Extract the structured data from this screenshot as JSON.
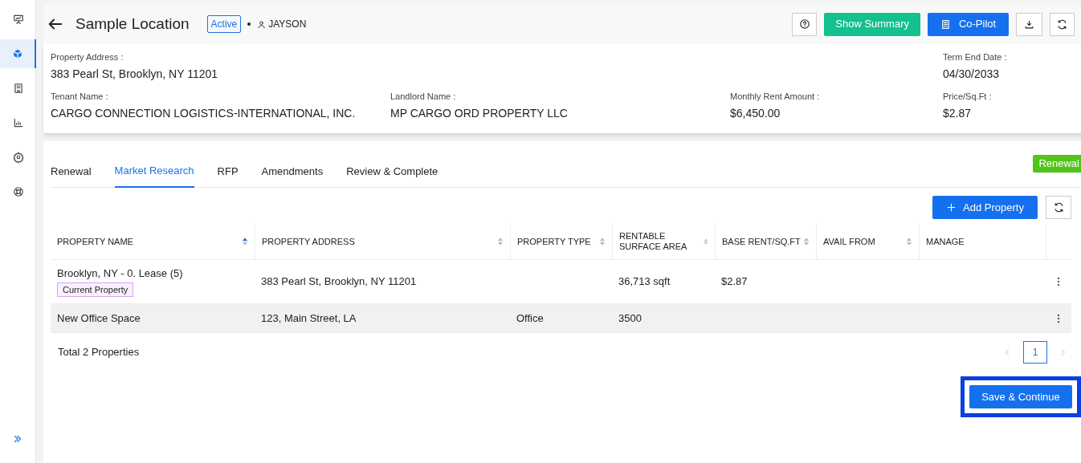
{
  "sidebar": {
    "items": [
      {
        "kind": "presentation",
        "selected": false
      },
      {
        "kind": "cube",
        "selected": true
      },
      {
        "kind": "building",
        "selected": false
      },
      {
        "kind": "chart",
        "selected": false
      },
      {
        "kind": "settings",
        "selected": false
      },
      {
        "kind": "support",
        "selected": false
      }
    ]
  },
  "header": {
    "title": "Sample Location",
    "status": "Active",
    "user": "JAYSON",
    "buttons": [
      {
        "kind": "help"
      },
      {
        "kind": "summary",
        "label": "Show Summary"
      },
      {
        "kind": "copilot",
        "label": "Co-Pilot"
      },
      {
        "kind": "download"
      },
      {
        "kind": "refresh"
      }
    ]
  },
  "details": [
    [
      {
        "label": "Property Address :",
        "value": "383 Pearl St, Brooklyn, NY 11201"
      },
      {
        "label": "Term End Date :",
        "value": "04/30/2033"
      }
    ],
    [
      {
        "label": "Tenant Name :",
        "value": "CARGO CONNECTION LOGISTICS-INTERNATIONAL, INC."
      },
      {
        "label": "Landlord Name :",
        "value": "MP CARGO ORD PROPERTY LLC"
      },
      {
        "label": "Monthly Rent Amount :",
        "value": "$6,450.00"
      },
      {
        "label": "Price/Sq.Ft :",
        "value": "$2.87"
      }
    ]
  ],
  "tabs": [
    {
      "label": "Renewal",
      "selected": false
    },
    {
      "label": "Market Research",
      "selected": true
    },
    {
      "label": "RFP",
      "selected": false
    },
    {
      "label": "Amendments",
      "selected": false
    },
    {
      "label": "Review & Complete",
      "selected": false
    }
  ],
  "ribbon": "Renewal",
  "add_button": "Add Property",
  "table": {
    "columns": [
      {
        "label": "PROPERTY NAME",
        "sorted": true
      },
      {
        "label": "PROPERTY ADDRESS",
        "sorted": false
      },
      {
        "label": "PROPERTY TYPE",
        "sorted": false
      },
      {
        "label": "RENTABLE SURFACE AREA",
        "sorted": false
      },
      {
        "label": "BASE RENT/SQ.FT",
        "sorted": false
      },
      {
        "label": "AVAIL FROM",
        "sorted": false
      },
      {
        "label": "MANAGE"
      }
    ],
    "rows": [
      {
        "property_name": "Brooklyn, NY - 0. Lease (5)",
        "property_address": "383 Pearl St, Brooklyn, NY 11201",
        "rentable_surface_area": "36,713 sqft",
        "base_rent": "$2.87",
        "badge": "Current Property",
        "shaded": false
      },
      {
        "property_name": "New Office Space",
        "property_address": "123, Main Street, LA",
        "property_type": "Office",
        "rentable_surface_area": "3500",
        "shaded": true
      }
    ]
  },
  "total": "Total 2 Properties",
  "pagination": {
    "pages": [
      {
        "label": "1",
        "selected": true
      }
    ]
  },
  "save_button": {
    "label": "Save & Continue",
    "focused": true
  }
}
